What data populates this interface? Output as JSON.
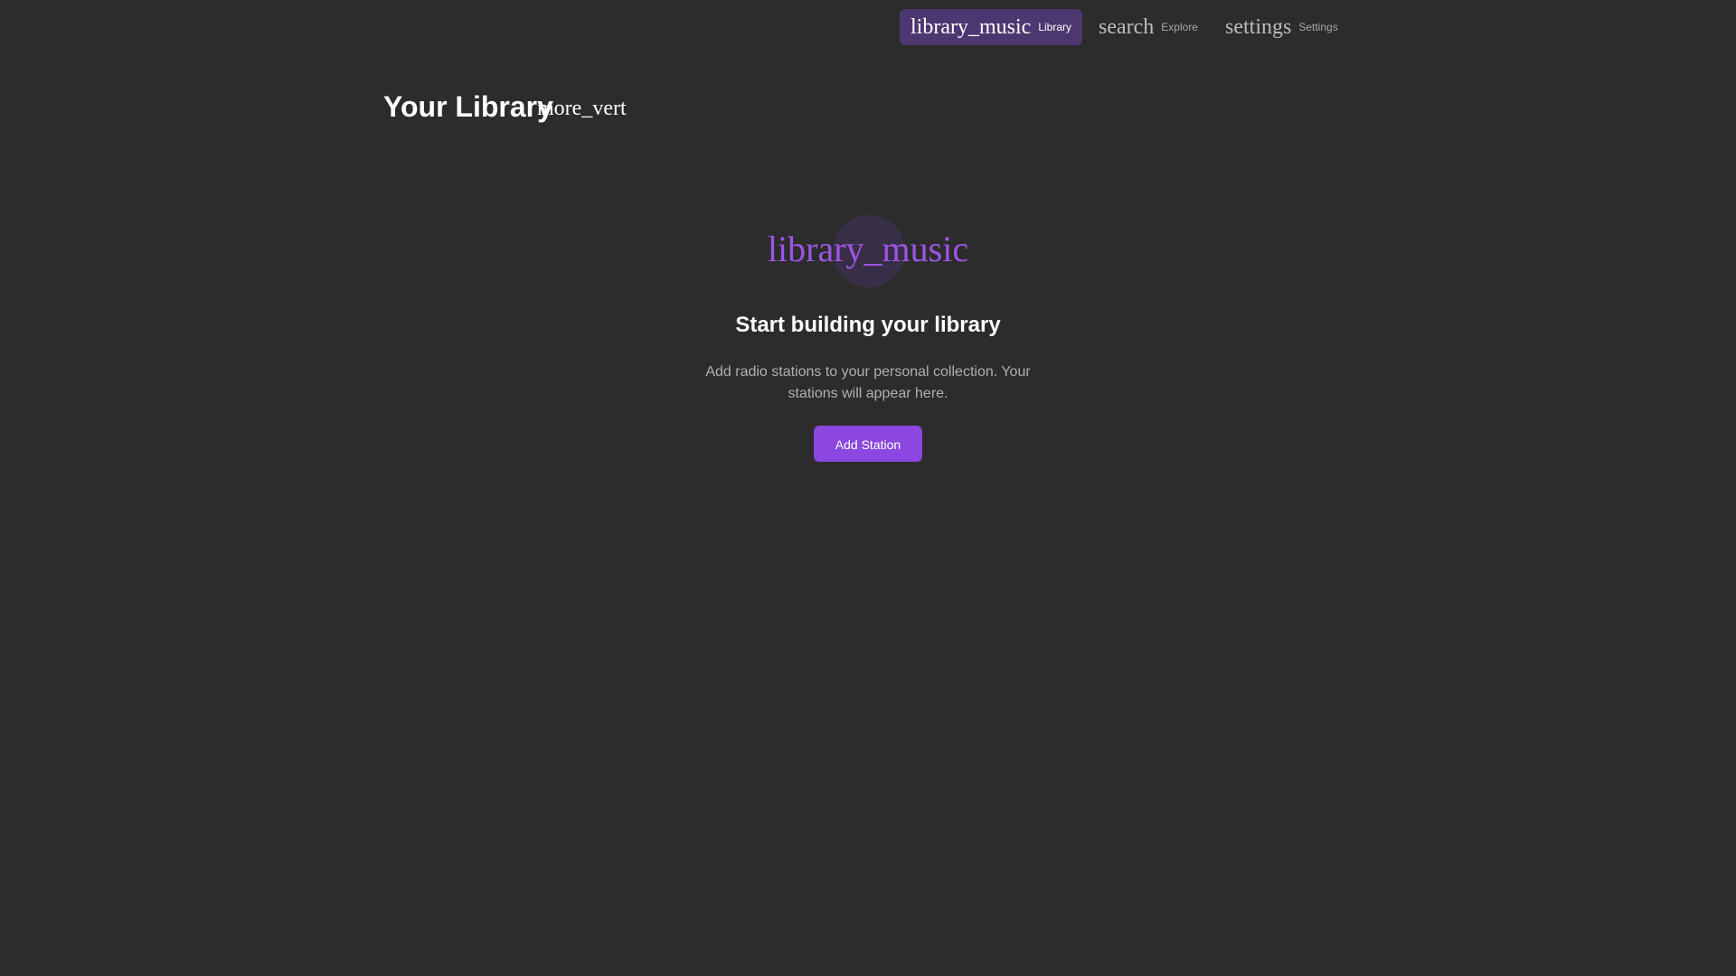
{
  "nav": {
    "items": [
      {
        "icon": "library_music",
        "label": "Library",
        "active": true
      },
      {
        "icon": "search",
        "label": "Explore",
        "active": false
      },
      {
        "icon": "settings",
        "label": "Settings",
        "active": false
      }
    ]
  },
  "header": {
    "title": "Your Library",
    "menu_icon": "more_vert"
  },
  "empty_state": {
    "icon": "library_music",
    "title": "Start building your library",
    "description": "Add radio stations to your personal collection. Your stations will appear here.",
    "button_label": "Add Station"
  },
  "colors": {
    "background": "#2c2c2c",
    "accent": "#8b47e0",
    "active_nav_bg": "#4d3770",
    "icon_accent": "#9d55e4"
  }
}
